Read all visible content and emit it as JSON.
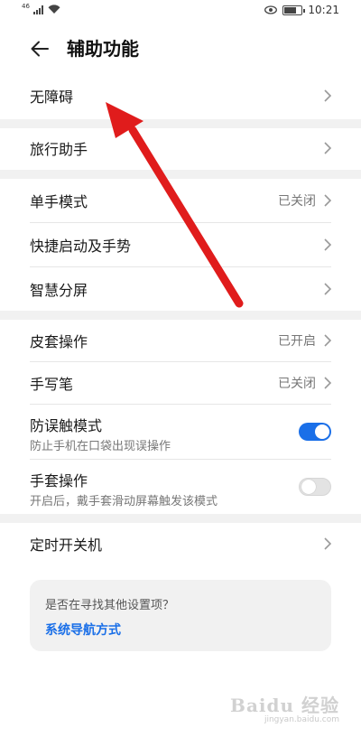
{
  "status_bar": {
    "network": "46",
    "time": "10:21",
    "battery_level": 0.7,
    "icons": [
      "signal-icon",
      "wifi-icon",
      "eye-icon",
      "battery-icon"
    ]
  },
  "header": {
    "title": "辅助功能",
    "back_icon": "back-arrow-icon"
  },
  "sections": {
    "accessibility": {
      "label": "无障碍"
    },
    "travel": {
      "label": "旅行助手"
    },
    "one_hand": {
      "label": "单手模式",
      "value": "已关闭"
    },
    "shortcuts": {
      "label": "快捷启动及手势"
    },
    "split_screen": {
      "label": "智慧分屏"
    },
    "cover": {
      "label": "皮套操作",
      "value": "已开启"
    },
    "stylus": {
      "label": "手写笔",
      "value": "已关闭"
    },
    "pocket_mode": {
      "label": "防误触模式",
      "sub": "防止手机在口袋出现误操作",
      "enabled": true
    },
    "glove_mode": {
      "label": "手套操作",
      "sub": "开启后，戴手套滑动屏幕触发该模式",
      "enabled": false
    },
    "scheduled_power": {
      "label": "定时开关机"
    }
  },
  "suggestion": {
    "question": "是否在寻找其他设置项？",
    "link": "系统导航方式"
  },
  "watermark": {
    "brand": "Baidu 经验",
    "url": "jingyan.baidu.com"
  },
  "colors": {
    "accent": "#1a6fe8",
    "annotation_arrow": "#e01c1c",
    "section_gap": "#f1f1f1"
  }
}
